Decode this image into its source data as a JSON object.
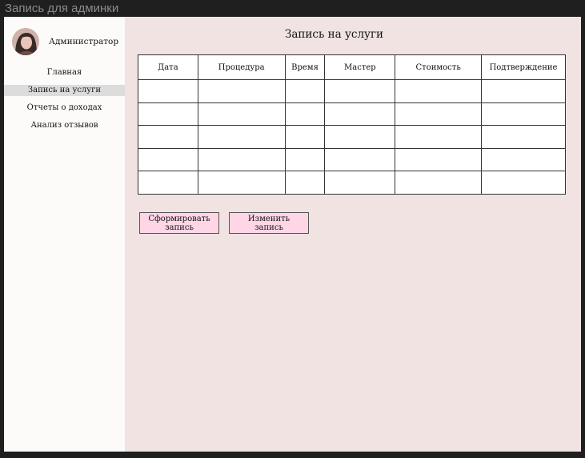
{
  "window": {
    "title": "Запись для админки"
  },
  "sidebar": {
    "user_name": "Администратор",
    "items": [
      {
        "label": "Главная",
        "active": false
      },
      {
        "label": "Запись на услуги",
        "active": true
      },
      {
        "label": "Отчеты о доходах",
        "active": false
      },
      {
        "label": "Анализ отзывов",
        "active": false
      }
    ]
  },
  "main": {
    "title": "Запись на услуги",
    "table": {
      "columns": [
        "Дата",
        "Процедура",
        "Время",
        "Мастер",
        "Стоимость",
        "Подтверждение"
      ],
      "rows": [
        [
          "",
          "",
          "",
          "",
          "",
          ""
        ],
        [
          "",
          "",
          "",
          "",
          "",
          ""
        ],
        [
          "",
          "",
          "",
          "",
          "",
          ""
        ],
        [
          "",
          "",
          "",
          "",
          "",
          ""
        ],
        [
          "",
          "",
          "",
          "",
          "",
          ""
        ]
      ]
    },
    "buttons": {
      "create_label_line1": "Сформировать",
      "create_label_line2": "запись",
      "edit_label_line1": "Изменить",
      "edit_label_line2": "запись"
    }
  },
  "colors": {
    "sidebar_bg": "#fdfbfa",
    "main_bg": "#f0e3e2",
    "active_item_bg": "#dcdcdc",
    "button_bg": "#ffd6e6",
    "frame_bg": "#1f1f1f"
  }
}
